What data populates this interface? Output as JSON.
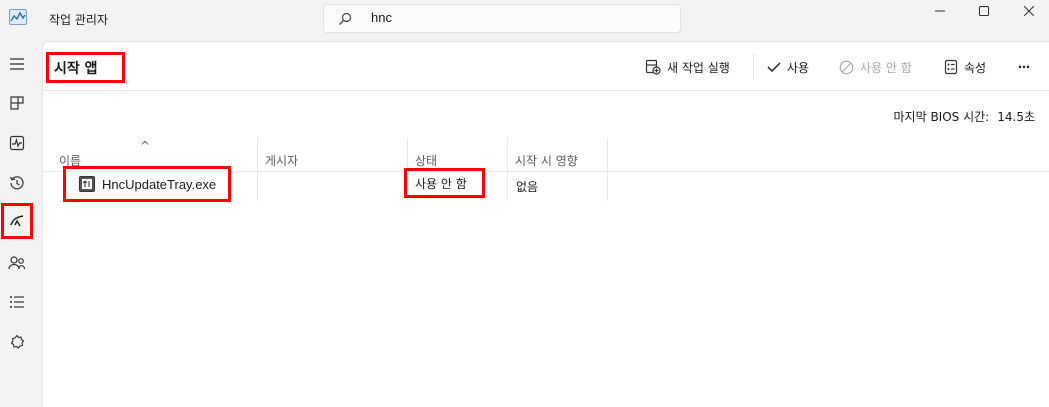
{
  "window": {
    "title": "작업 관리자"
  },
  "search": {
    "value": "hnc",
    "icon": "search-icon"
  },
  "sidebar": {
    "items": [
      {
        "name": "hamburger-menu",
        "icon": "menu-icon"
      },
      {
        "name": "processes",
        "icon": "processes-icon"
      },
      {
        "name": "performance",
        "icon": "performance-icon"
      },
      {
        "name": "app-history",
        "icon": "history-icon"
      },
      {
        "name": "startup-apps",
        "icon": "startup-icon",
        "selected": true
      },
      {
        "name": "users",
        "icon": "users-icon"
      },
      {
        "name": "details",
        "icon": "details-icon"
      },
      {
        "name": "services",
        "icon": "services-icon"
      }
    ]
  },
  "page": {
    "title": "시작 앱"
  },
  "toolbar": {
    "run_new_task": "새 작업 실행",
    "enable": "사용",
    "disable": "사용 안 함",
    "properties": "속성",
    "more": "⋯"
  },
  "bios": {
    "label": "마지막 BIOS 시간:",
    "value": "14.5초"
  },
  "table": {
    "sort_indicator": "^",
    "columns": [
      "이름",
      "게시자",
      "상태",
      "시작 시 영향"
    ],
    "rows": [
      {
        "name": "HncUpdateTray.exe",
        "publisher": "",
        "status": "사용 안 함",
        "impact": "없음"
      }
    ]
  },
  "colors": {
    "highlight": "#ff0000",
    "accent": "#0067c0",
    "disabled": "#a9a9a9"
  }
}
